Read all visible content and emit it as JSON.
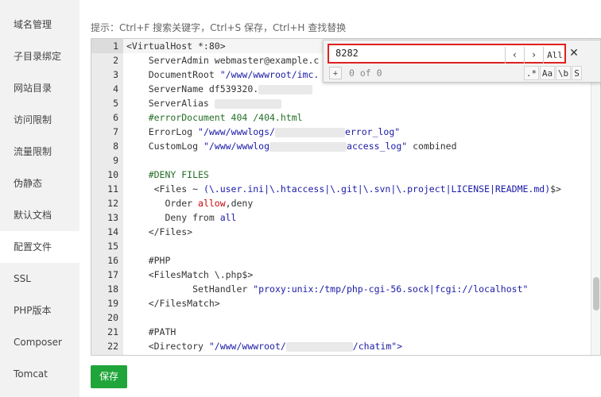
{
  "sidebar": {
    "items": [
      {
        "label": "域名管理"
      },
      {
        "label": "子目录绑定"
      },
      {
        "label": "网站目录"
      },
      {
        "label": "访问限制"
      },
      {
        "label": "流量限制"
      },
      {
        "label": "伪静态"
      },
      {
        "label": "默认文档"
      },
      {
        "label": "配置文件",
        "active": true
      },
      {
        "label": "SSL"
      },
      {
        "label": "PHP版本"
      },
      {
        "label": "Composer"
      },
      {
        "label": "Tomcat"
      }
    ]
  },
  "hint": "提示：Ctrl+F 搜索关键字，Ctrl+S 保存，Ctrl+H 查找替换",
  "editor": {
    "line_numbers": [
      "1",
      "2",
      "3",
      "4",
      "5",
      "6",
      "7",
      "8",
      "9",
      "10",
      "11",
      "12",
      "13",
      "14",
      "15",
      "16",
      "17",
      "18",
      "19",
      "20",
      "21",
      "22"
    ],
    "lines": {
      "l1": "<VirtualHost *:80>",
      "l2": "    ServerAdmin webmaster@example.c",
      "l3a": "    DocumentRoot ",
      "l3b": "\"/www/wwwroot/imc.",
      "l4": "    ServerName df539320.",
      "l5": "    ServerAlias ",
      "l6": "    #errorDocument 404 /404.html",
      "l7a": "    ErrorLog ",
      "l7b": "\"/www/wwwlogs/",
      "l7c": "error_log\"",
      "l8a": "    CustomLog ",
      "l8b": "\"/www/wwwlog",
      "l8c": "access_log\"",
      "l8d": " combined",
      "l10": "    #DENY FILES",
      "l11a": "     <Files ~ ",
      "l11b": "(\\.user.ini|\\.htaccess|\\.git|\\.svn|\\.project|LICENSE|README.md)",
      "l11c": "$>",
      "l12a": "       Order ",
      "l12b": "allow",
      "l12c": ",deny",
      "l13a": "       Deny from ",
      "l13b": "all",
      "l14": "    </Files>",
      "l16": "    #PHP",
      "l17": "    <FilesMatch \\.php$>",
      "l18a": "            SetHandler ",
      "l18b": "\"proxy:unix:/tmp/php-cgi-56.sock|fcgi://localhost\"",
      "l19": "    </FilesMatch>",
      "l21": "    #PATH",
      "l22a": "    <Directory ",
      "l22b": "\"/www/wwwroot/",
      "l22c": "/chatim\">"
    }
  },
  "search": {
    "query": "8282",
    "prev_icon": "‹",
    "next_icon": "›",
    "all_label": "All",
    "close_icon": "✕",
    "replace_toggle": "+",
    "counter": "0 of 0",
    "opt_regex": ".*",
    "opt_case": "Aa",
    "opt_word": "\\b",
    "opt_selection": "S"
  },
  "save_button": "保存",
  "colors": {
    "save_green": "#20a53a",
    "search_border": "#e02020"
  }
}
